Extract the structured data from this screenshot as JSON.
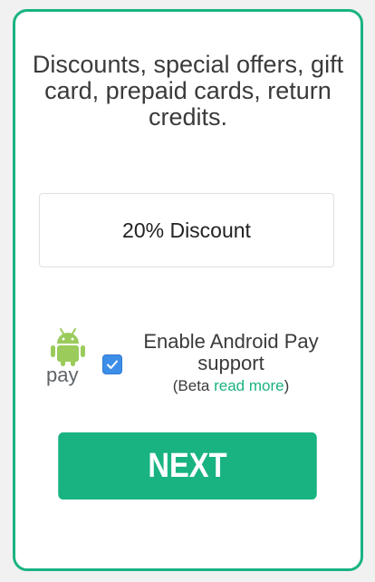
{
  "colors": {
    "accent": "#19b382",
    "checkbox": "#3c8ee8",
    "text": "#3a3a3a"
  },
  "card": {
    "headline": "Discounts, special offers, gift card, prepaid cards, return credits.",
    "discount_value": "20% Discount",
    "android_pay": {
      "logo_text": "pay",
      "checkbox_checked": true,
      "label_line1": "Enable Android Pay",
      "label_line2": "support",
      "beta_prefix": "(Beta ",
      "beta_link": "read more",
      "beta_suffix": ")"
    },
    "next_label": "NEXT"
  },
  "icons": {
    "logo": "android-pay-logo-icon",
    "check": "checkmark-icon"
  }
}
